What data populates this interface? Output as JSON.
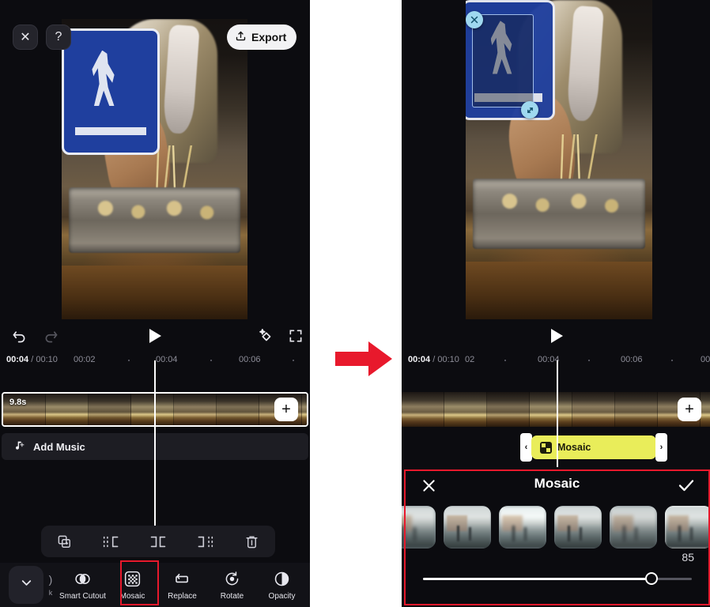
{
  "app": {
    "name": "video-editor",
    "accent_yellow": "#e9ed5a",
    "annotation_red": "#e8192c",
    "background": "#0c0c10"
  },
  "left_panel": {
    "header": {
      "close_label": "✕",
      "help_label": "?",
      "export_label": "Export",
      "export_icon": "upload-icon"
    },
    "playback": {
      "undo_icon": "undo-icon",
      "redo_icon": "redo-icon",
      "play_icon": "play-icon",
      "enhance_icon": "sparkle-diamond-icon",
      "fullscreen_icon": "fullscreen-icon"
    },
    "ruler": {
      "current_time": "00:04",
      "separator": "/",
      "total_time": "00:10",
      "ticks": [
        "00:02",
        "00:04",
        "00:06"
      ]
    },
    "timeline": {
      "clip_duration": "9.8s",
      "add_button_label": "+",
      "music_label": "Add Music",
      "music_icon": "music-note-icon"
    },
    "clip_tools": [
      {
        "name": "duplicate",
        "icon": "copy-plus-icon"
      },
      {
        "name": "trim-left",
        "icon": "trim-left-icon"
      },
      {
        "name": "split",
        "icon": "split-icon"
      },
      {
        "name": "trim-right",
        "icon": "trim-right-icon"
      },
      {
        "name": "delete",
        "icon": "trash-icon"
      }
    ],
    "bottom_nav": {
      "collapse_icon": "chevron-down-icon",
      "items": [
        {
          "label": "Smart Cutout",
          "icon": "smart-cutout-icon",
          "selected": false
        },
        {
          "label": "Mosaic",
          "icon": "mosaic-grid-icon",
          "selected": true
        },
        {
          "label": "Replace",
          "icon": "replace-icon",
          "selected": false
        },
        {
          "label": "Rotate",
          "icon": "rotate-icon",
          "selected": false
        },
        {
          "label": "Opacity",
          "icon": "opacity-icon",
          "selected": false
        }
      ]
    }
  },
  "right_panel": {
    "selection": {
      "close_handle_icon": "close-handle-icon",
      "resize_handle_icon": "resize-diagonal-icon"
    },
    "playback": {
      "play_icon": "play-icon"
    },
    "ruler": {
      "current_time": "00:04",
      "separator": "/",
      "total_time": "00:10",
      "ticks": [
        "02",
        "00:04",
        "00:06",
        "00"
      ]
    },
    "timeline": {
      "add_button_label": "+",
      "mosaic_track_label": "Mosaic",
      "mosaic_track_icon": "mosaic-badge-icon",
      "handle_left": "‹",
      "handle_right": "›"
    },
    "mosaic_sheet": {
      "title": "Mosaic",
      "cancel_icon": "close-icon",
      "confirm_icon": "check-icon",
      "intensity_value": "85",
      "slider_percent": 85,
      "presets": [
        {
          "name": "preset-1",
          "selected": false
        },
        {
          "name": "preset-2",
          "selected": false
        },
        {
          "name": "preset-3",
          "selected": false
        },
        {
          "name": "preset-4",
          "selected": false
        },
        {
          "name": "preset-5",
          "selected": false
        },
        {
          "name": "preset-6",
          "selected": true
        }
      ]
    }
  },
  "annotations": {
    "arrow_icon": "right-arrow-icon",
    "highlight_mosaic_nav": "mosaic-nav-highlight",
    "highlight_mosaic_sheet": "mosaic-sheet-highlight"
  }
}
